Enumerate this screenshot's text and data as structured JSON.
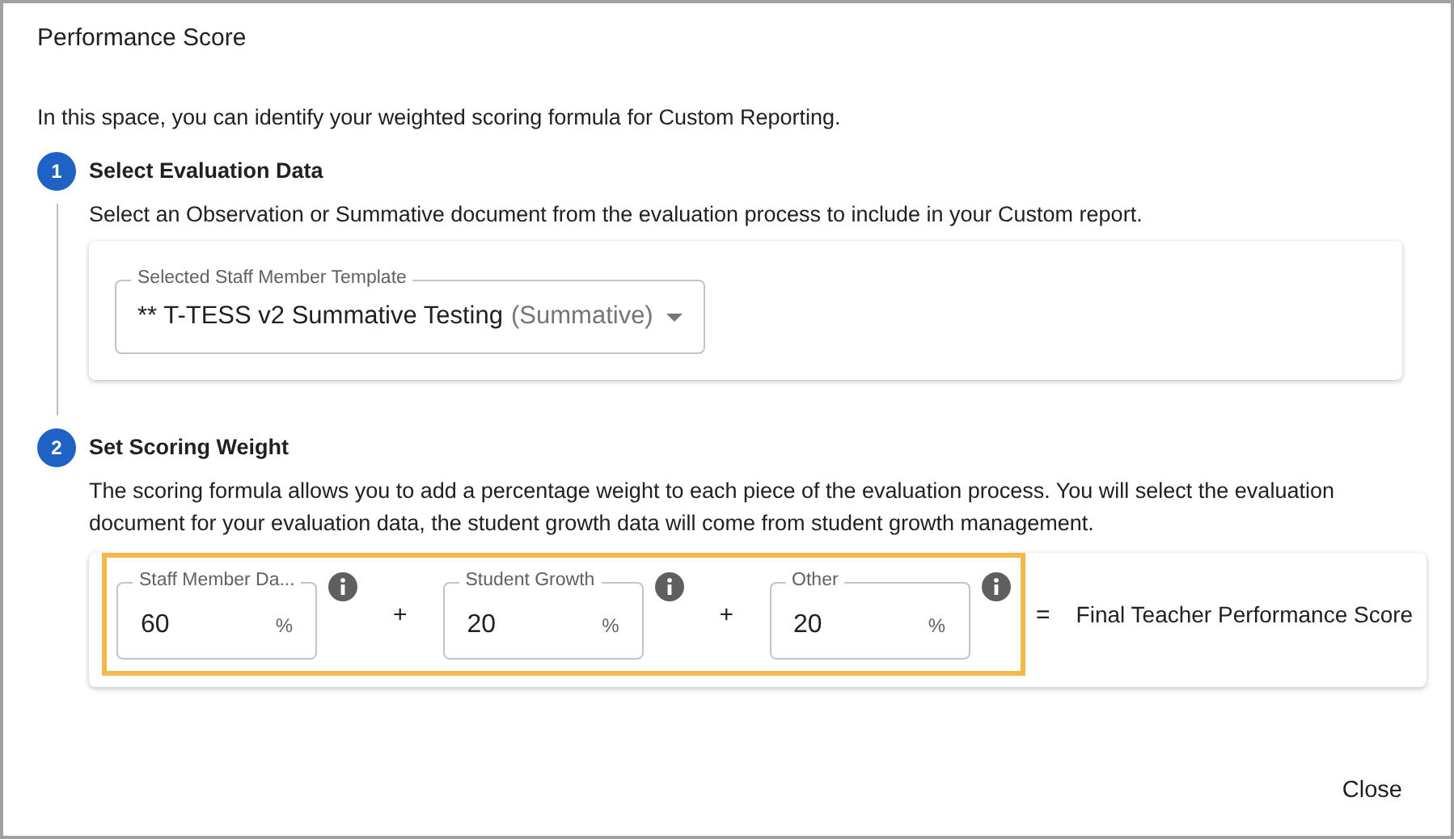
{
  "dialog": {
    "title": "Performance Score",
    "intro": "In this space, you can identify your weighted scoring formula for Custom Reporting.",
    "steps": [
      {
        "number": "1",
        "title": "Select Evaluation Data",
        "description": "Select an Observation or Summative document from the evaluation process to include in your Custom report.",
        "kind": "select",
        "select": {
          "label": "Selected Staff Member Template",
          "value": "** T-TESS v2 Summative Testing",
          "suffix": "(Summative)"
        }
      },
      {
        "number": "2",
        "title": "Set Scoring Weight",
        "description": "The scoring formula allows you to add a percentage weight to each piece of the evaluation process. You will select the evaluation document for your evaluation data, the student growth data will come from student growth management.",
        "kind": "weights",
        "weights": [
          {
            "label": "Staff Member Da...",
            "value": "60",
            "unit": "%",
            "operator": "+"
          },
          {
            "label": "Student Growth",
            "value": "20",
            "unit": "%",
            "operator": "+"
          },
          {
            "label": "Other",
            "value": "20",
            "unit": "%"
          }
        ],
        "equals": "=",
        "result": "Final Teacher Performance Score"
      }
    ],
    "buttons": [
      "Close"
    ]
  }
}
